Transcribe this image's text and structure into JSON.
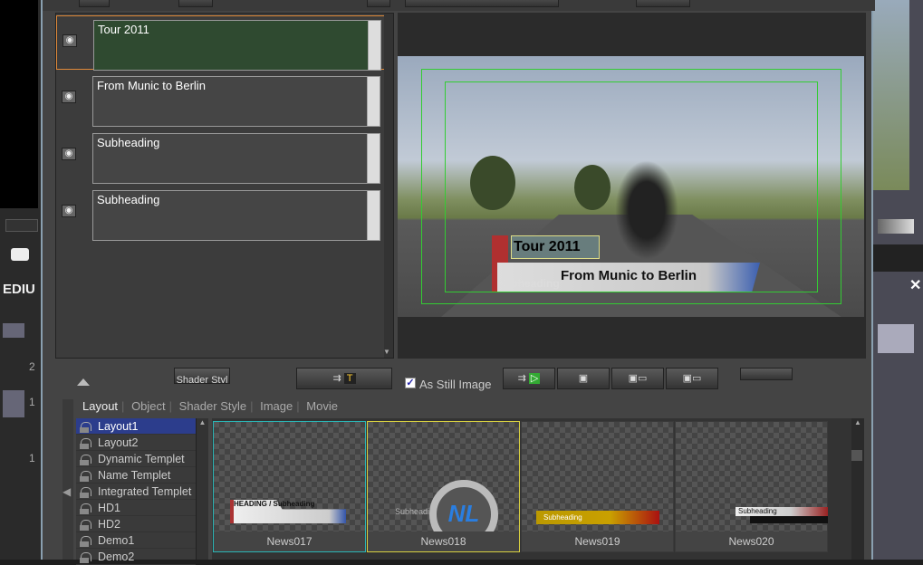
{
  "left_editor": {
    "brand": "EDIU",
    "tracks": [
      "2",
      "1",
      "1"
    ]
  },
  "text_rows": [
    {
      "value": "Tour 2011",
      "selected": true
    },
    {
      "value": "From Munic to Berlin",
      "selected": false
    },
    {
      "value": "Subheading",
      "selected": false
    },
    {
      "value": "Subheading",
      "selected": false
    }
  ],
  "preview": {
    "heading": "Tour 2011",
    "subtitle": "From Munic to Berlin",
    "subheading": "Subheading"
  },
  "toolbar": {
    "shader_style": "Shader Styl",
    "as_still_image": "As Still Image",
    "as_still_checked": true
  },
  "tabs": [
    "Layout",
    "Object",
    "Shader Style",
    "Image",
    "Movie"
  ],
  "layouts": [
    "Layout1",
    "Layout2",
    "Dynamic Templet",
    "Name Templet",
    "Integrated Templet",
    "HD1",
    "HD2",
    "Demo1",
    "Demo2"
  ],
  "thumbnails": [
    {
      "name": "News017",
      "art": "HEADING / Subheading",
      "border": "#2ab5b5"
    },
    {
      "name": "News018",
      "art": "Subheading",
      "border": "#d8d040"
    },
    {
      "name": "News019",
      "art": "Subheading",
      "border": ""
    },
    {
      "name": "News020",
      "art": "Subheading",
      "border": ""
    }
  ],
  "colors": {
    "selected_row": "#2f4a30",
    "selection_outline": "#e08a3a",
    "list_selected": "#2c3d8c",
    "safe_area": "#33cc33"
  }
}
